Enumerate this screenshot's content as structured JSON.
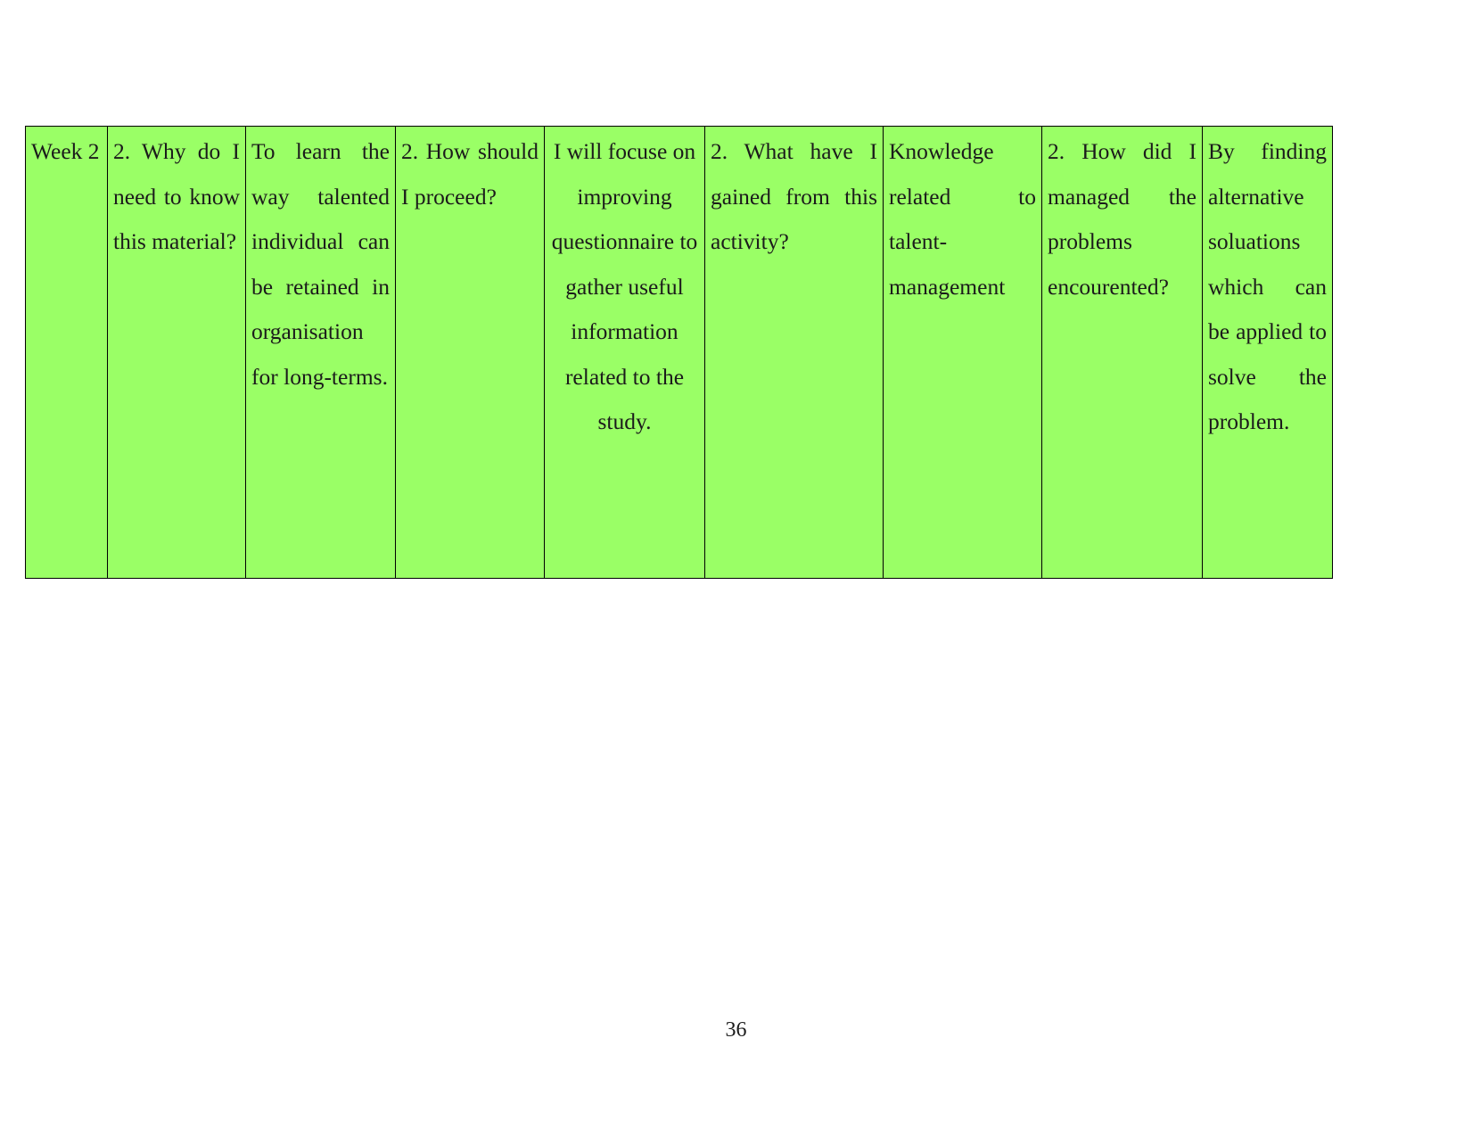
{
  "document": {
    "page_number": "36",
    "background_color": "#ffffff",
    "cell_fill_color": "#9aff66",
    "border_color": "#000000",
    "text_color": "#1b1b1b"
  },
  "table": {
    "name": "weekly-reflective-journal-table",
    "row_count": 1,
    "column_count": 9,
    "rows": [
      {
        "cells": [
          {
            "id": "week-label",
            "text": "Week 2",
            "align": "left"
          },
          {
            "id": "question-1",
            "text": "2. Why do I need to know this material?",
            "align": "justify"
          },
          {
            "id": "answer-1",
            "text": "To learn the way talented individual can be retained in organisation for long-terms.",
            "align": "justify"
          },
          {
            "id": "question-2",
            "text": "2. How should I proceed?",
            "align": "justify"
          },
          {
            "id": "answer-2",
            "text": "I will focuse on improving questionnaire to gather useful information related to the study.",
            "align": "center"
          },
          {
            "id": "question-3",
            "text": "2. What have I gained from this activity?",
            "align": "justify"
          },
          {
            "id": "answer-3",
            "text": "Knowledge related to talent-management",
            "align": "justify"
          },
          {
            "id": "question-4",
            "text": "2. How did I managed the problems encourented?",
            "align": "justify"
          },
          {
            "id": "answer-4",
            "text": "By finding alternative soluations which can be applied to solve the problem.",
            "align": "justify"
          }
        ]
      }
    ]
  }
}
